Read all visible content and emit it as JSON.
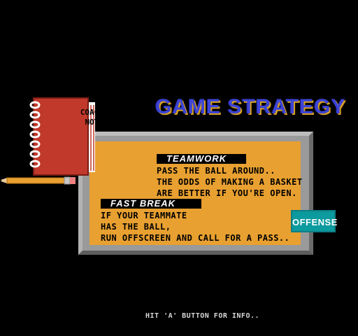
{
  "screen": {
    "title": "GAME STRATEGY",
    "notebook_label_line1": "COACH'S",
    "notebook_label_line2": "NOTES",
    "sections": [
      {
        "header": "TEAMWORK",
        "lines": [
          "PASS THE BALL AROUND..",
          "THE ODDS OF MAKING A BASKET",
          "ARE BETTER IF YOU'RE OPEN."
        ]
      },
      {
        "header": "FAST BREAK",
        "lines": [
          "IF YOUR TEAMMATE",
          "HAS THE BALL,",
          "RUN OFFSCREEN AND CALL FOR A PASS.."
        ]
      }
    ],
    "mode_button": "OFFENSE",
    "hint": "HIT 'A' BUTTON FOR INFO.."
  },
  "colors": {
    "background": "#000000",
    "board_orange": "#e8a030",
    "frame_gray": "#9a9a9a",
    "title_blue": "#3d45d6",
    "notebook_red": "#c0392b",
    "offense_teal": "#0b9a9e"
  }
}
